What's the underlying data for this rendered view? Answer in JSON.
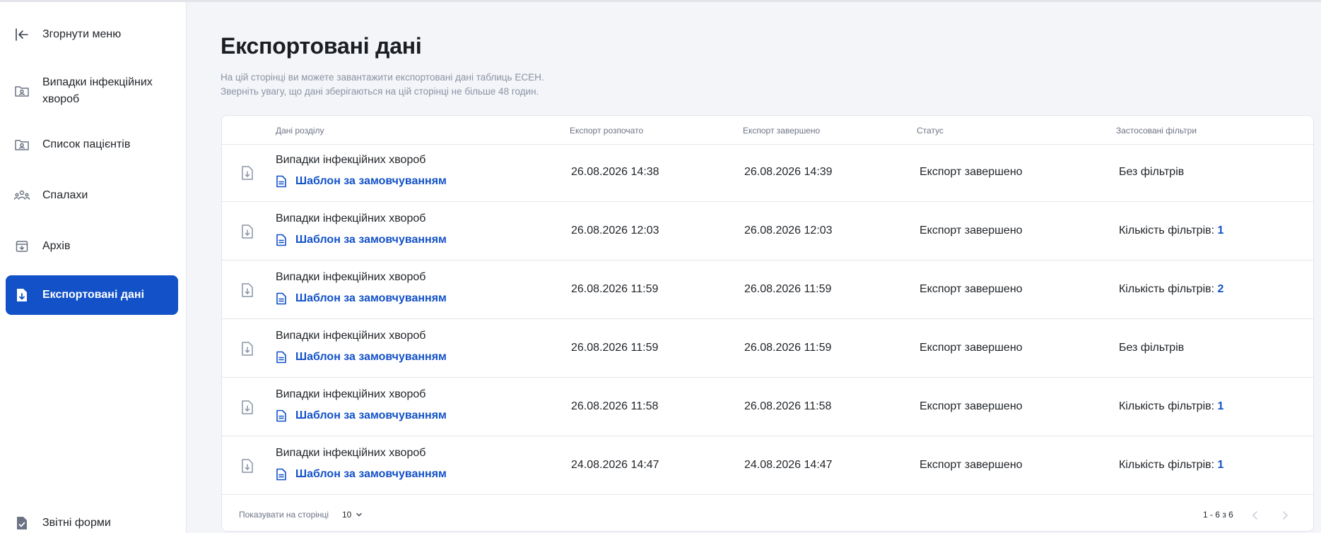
{
  "sidebar": {
    "collapse_label": "Згорнути меню",
    "items": [
      {
        "label": "Випадки інфекційних\nхвороб"
      },
      {
        "label": "Список пацієнтів"
      },
      {
        "label": "Спалахи"
      },
      {
        "label": "Архів"
      },
      {
        "label": "Експортовані дані"
      },
      {
        "label": "Звітні форми"
      }
    ]
  },
  "page": {
    "title": "Експортовані дані",
    "subtitle_line1": "На цій сторінці ви можете завантажити експортовані дані таблиць ЕСЕН.",
    "subtitle_line2": "Зверніть увагу, що дані зберігаються на цій сторінці не більше 48 годин."
  },
  "table": {
    "headers": {
      "section": "Дані розділу",
      "started": "Експорт розпочато",
      "finished": "Експорт завершено",
      "status": "Статус",
      "filters": "Застосовані фільтри"
    },
    "rows": [
      {
        "section": "Випадки інфекційних хвороб",
        "template": "Шаблон за замовчуванням",
        "started": "26.08.2026 14:38",
        "finished": "26.08.2026 14:39",
        "status": "Експорт завершено",
        "filters_text": "Без фільтрів",
        "filters_count": ""
      },
      {
        "section": "Випадки інфекційних хвороб",
        "template": "Шаблон за замовчуванням",
        "started": "26.08.2026 12:03",
        "finished": "26.08.2026 12:03",
        "status": "Експорт завершено",
        "filters_text": "Кількість фільтрів:",
        "filters_count": "1"
      },
      {
        "section": "Випадки інфекційних хвороб",
        "template": "Шаблон за замовчуванням",
        "started": "26.08.2026 11:59",
        "finished": "26.08.2026 11:59",
        "status": "Експорт завершено",
        "filters_text": "Кількість фільтрів:",
        "filters_count": "2"
      },
      {
        "section": "Випадки інфекційних хвороб",
        "template": "Шаблон за замовчуванням",
        "started": "26.08.2026 11:59",
        "finished": "26.08.2026 11:59",
        "status": "Експорт завершено",
        "filters_text": "Без фільтрів",
        "filters_count": ""
      },
      {
        "section": "Випадки інфекційних хвороб",
        "template": "Шаблон за замовчуванням",
        "started": "26.08.2026 11:58",
        "finished": "26.08.2026 11:58",
        "status": "Експорт завершено",
        "filters_text": "Кількість фільтрів:",
        "filters_count": "1"
      },
      {
        "section": "Випадки інфекційних хвороб",
        "template": "Шаблон за замовчуванням",
        "started": "24.08.2026 14:47",
        "finished": "24.08.2026 14:47",
        "status": "Експорт завершено",
        "filters_text": "Кількість фільтрів:",
        "filters_count": "1"
      }
    ]
  },
  "pagination": {
    "per_page_label": "Показувати на сторінці",
    "per_page_value": "10",
    "range": "1 - 6 з 6"
  },
  "icons": {
    "collapse": "arrow-left-to-bar-icon",
    "cases": "folder-person-icon",
    "patients": "folder-person-icon",
    "outbreaks": "people-group-icon",
    "archive": "archive-box-icon",
    "exported": "file-download-icon",
    "reports": "file-check-icon"
  },
  "colors": {
    "accent": "#1251c8",
    "muted": "#8a93a5",
    "border": "#e3e5ea",
    "background": "#f4f5f8"
  }
}
